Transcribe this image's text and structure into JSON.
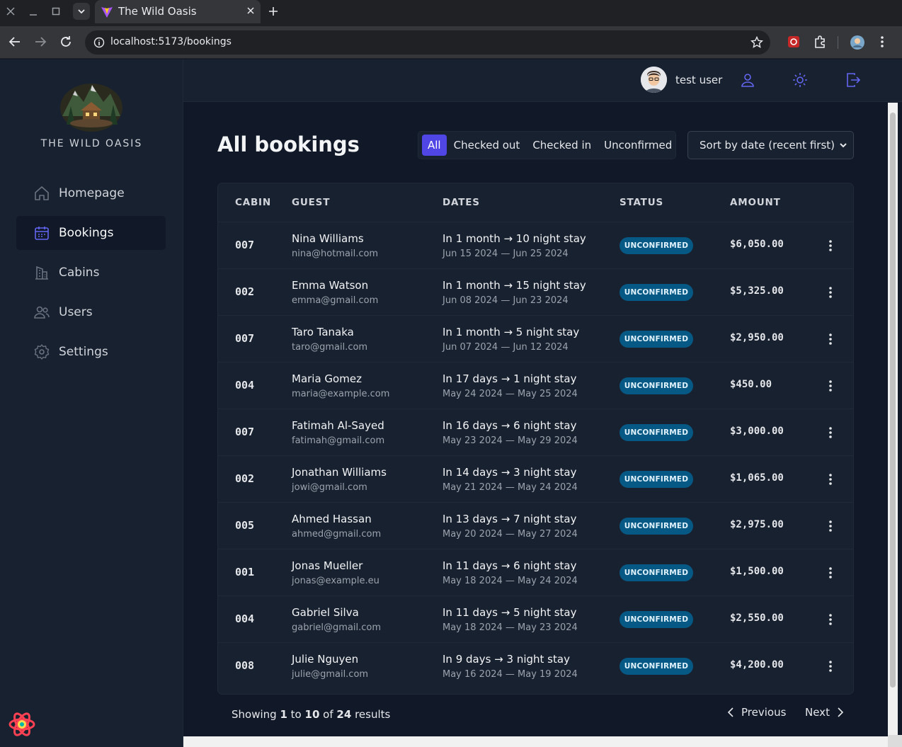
{
  "browser": {
    "tab_title": "The Wild Oasis",
    "url": "localhost:5173/bookings"
  },
  "app": {
    "brand": "THE WILD OASIS",
    "nav": [
      {
        "label": "Homepage",
        "icon": "home-icon"
      },
      {
        "label": "Bookings",
        "icon": "calendar-icon",
        "active": true
      },
      {
        "label": "Cabins",
        "icon": "building-icon"
      },
      {
        "label": "Users",
        "icon": "users-icon"
      },
      {
        "label": "Settings",
        "icon": "gear-icon"
      }
    ]
  },
  "header": {
    "username": "test user"
  },
  "page": {
    "title": "All bookings",
    "filters": [
      "All",
      "Checked out",
      "Checked in",
      "Unconfirmed"
    ],
    "active_filter": "All",
    "sort_label": "Sort by date (recent first)"
  },
  "table": {
    "headers": [
      "CABIN",
      "GUEST",
      "DATES",
      "STATUS",
      "AMOUNT"
    ],
    "rows": [
      {
        "cabin": "007",
        "guest": "Nina Williams",
        "email": "nina@hotmail.com",
        "range": "In 1 month → 10 night stay",
        "dates": "Jun 15 2024 — Jun 25 2024",
        "status": "UNCONFIRMED",
        "amount": "$6,050.00"
      },
      {
        "cabin": "002",
        "guest": "Emma Watson",
        "email": "emma@gmail.com",
        "range": "In 1 month → 15 night stay",
        "dates": "Jun 08 2024 — Jun 23 2024",
        "status": "UNCONFIRMED",
        "amount": "$5,325.00"
      },
      {
        "cabin": "007",
        "guest": "Taro Tanaka",
        "email": "taro@gmail.com",
        "range": "In 1 month → 5 night stay",
        "dates": "Jun 07 2024 — Jun 12 2024",
        "status": "UNCONFIRMED",
        "amount": "$2,950.00"
      },
      {
        "cabin": "004",
        "guest": "Maria Gomez",
        "email": "maria@example.com",
        "range": "In 17 days → 1 night stay",
        "dates": "May 24 2024 — May 25 2024",
        "status": "UNCONFIRMED",
        "amount": "$450.00"
      },
      {
        "cabin": "007",
        "guest": "Fatimah Al-Sayed",
        "email": "fatimah@gmail.com",
        "range": "In 16 days → 6 night stay",
        "dates": "May 23 2024 — May 29 2024",
        "status": "UNCONFIRMED",
        "amount": "$3,000.00"
      },
      {
        "cabin": "002",
        "guest": "Jonathan Williams",
        "email": "jowi@gmail.com",
        "range": "In 14 days → 3 night stay",
        "dates": "May 21 2024 — May 24 2024",
        "status": "UNCONFIRMED",
        "amount": "$1,065.00"
      },
      {
        "cabin": "005",
        "guest": "Ahmed Hassan",
        "email": "ahmed@gmail.com",
        "range": "In 13 days → 7 night stay",
        "dates": "May 20 2024 — May 27 2024",
        "status": "UNCONFIRMED",
        "amount": "$2,975.00"
      },
      {
        "cabin": "001",
        "guest": "Jonas Mueller",
        "email": "jonas@example.eu",
        "range": "In 11 days → 6 night stay",
        "dates": "May 18 2024 — May 24 2024",
        "status": "UNCONFIRMED",
        "amount": "$1,500.00"
      },
      {
        "cabin": "004",
        "guest": "Gabriel Silva",
        "email": "gabriel@gmail.com",
        "range": "In 11 days → 5 night stay",
        "dates": "May 18 2024 — May 23 2024",
        "status": "UNCONFIRMED",
        "amount": "$2,550.00"
      },
      {
        "cabin": "008",
        "guest": "Julie Nguyen",
        "email": "julie@gmail.com",
        "range": "In 9 days → 3 night stay",
        "dates": "May 16 2024 — May 19 2024",
        "status": "UNCONFIRMED",
        "amount": "$4,200.00"
      }
    ]
  },
  "pagination": {
    "prefix": "Showing",
    "from": "1",
    "to_word": "to",
    "to": "10",
    "of_word": "of",
    "total": "24",
    "suffix": "results",
    "prev_label": "Previous",
    "next_label": "Next"
  },
  "colors": {
    "accent": "#4f46e5",
    "badge_bg": "#075985",
    "sidebar_bg": "#18212f",
    "main_bg": "#111827"
  }
}
